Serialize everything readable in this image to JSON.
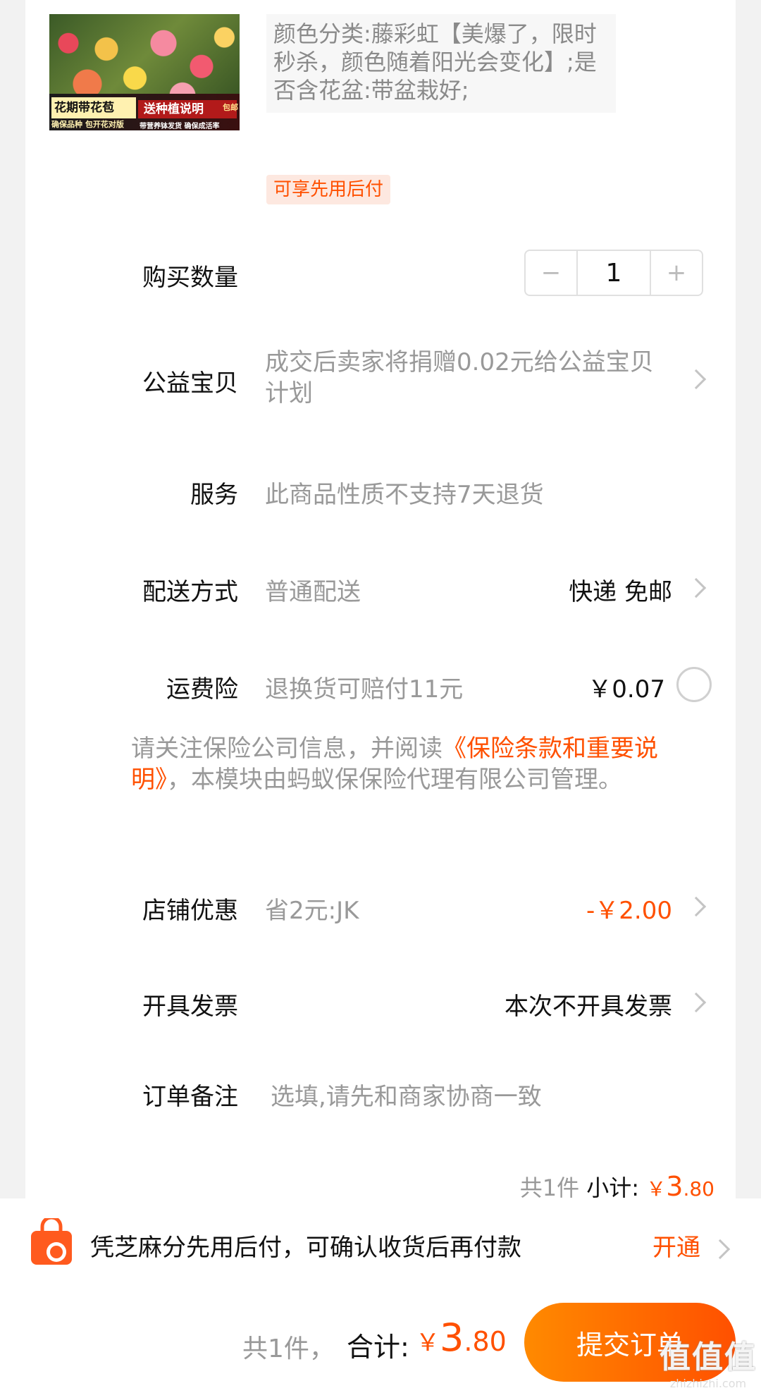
{
  "product": {
    "image_text": {
      "tag1": "花期带花苞",
      "sub1": "确保品种 包开花对版",
      "tag2": "送种植说明",
      "badge": "包邮",
      "sub2": "带营养钵发货 确保成活率"
    },
    "variant_text": "颜色分类:藤彩虹【美爆了，限时秒杀，颜色随着阳光会变化】;是否含花盆:带盆栽好;",
    "paylater_tag": "可享先用后付"
  },
  "rows": {
    "quantity": {
      "label": "购买数量",
      "minus": "−",
      "value": "1",
      "plus": "+"
    },
    "charity": {
      "label": "公益宝贝",
      "value": "成交后卖家将捐赠0.02元给公益宝贝计划"
    },
    "service": {
      "label": "服务",
      "value": "此商品性质不支持7天退货"
    },
    "delivery": {
      "label": "配送方式",
      "value": "普通配送",
      "right": "快递 免邮"
    },
    "insurance": {
      "label": "运费险",
      "value": "退换货可赔付11元",
      "price": "￥0.07"
    },
    "notice": {
      "prefix": "请关注保险公司信息，并阅读",
      "link": "《保险条款和重要说明》",
      "suffix": "，本模块由蚂蚁保保险代理有限公司管理。"
    },
    "shop_discount": {
      "label": "店铺优惠",
      "value": "省2元:JK",
      "amount": "-￥2.00"
    },
    "invoice": {
      "label": "开具发票",
      "right": "本次不开具发票"
    },
    "remark": {
      "label": "订单备注",
      "placeholder": "选填,请先和商家协商一致"
    }
  },
  "subtotal": {
    "count": "共1件",
    "label": "小计:",
    "symbol": "￥",
    "integer": "3",
    "decimal": ".80"
  },
  "banner": {
    "text": "凭芝麻分先用后付，可确认收货后再付款",
    "action": "开通"
  },
  "bottom": {
    "count": "共1件，",
    "total_label": "合计:",
    "symbol": "￥",
    "integer": "3",
    "decimal": ".80",
    "submit": "提交订单",
    "watermark": "值值值",
    "watermark_sub": "zhizhizhi.com"
  },
  "colors": {
    "accent": "#ff5000",
    "accent_gradient_start": "#ff8a00",
    "muted": "#999999",
    "background": "#f2f2f2"
  },
  "icons": [
    "chevron-right-icon",
    "shopping-bag-icon",
    "radio-unchecked-icon"
  ]
}
